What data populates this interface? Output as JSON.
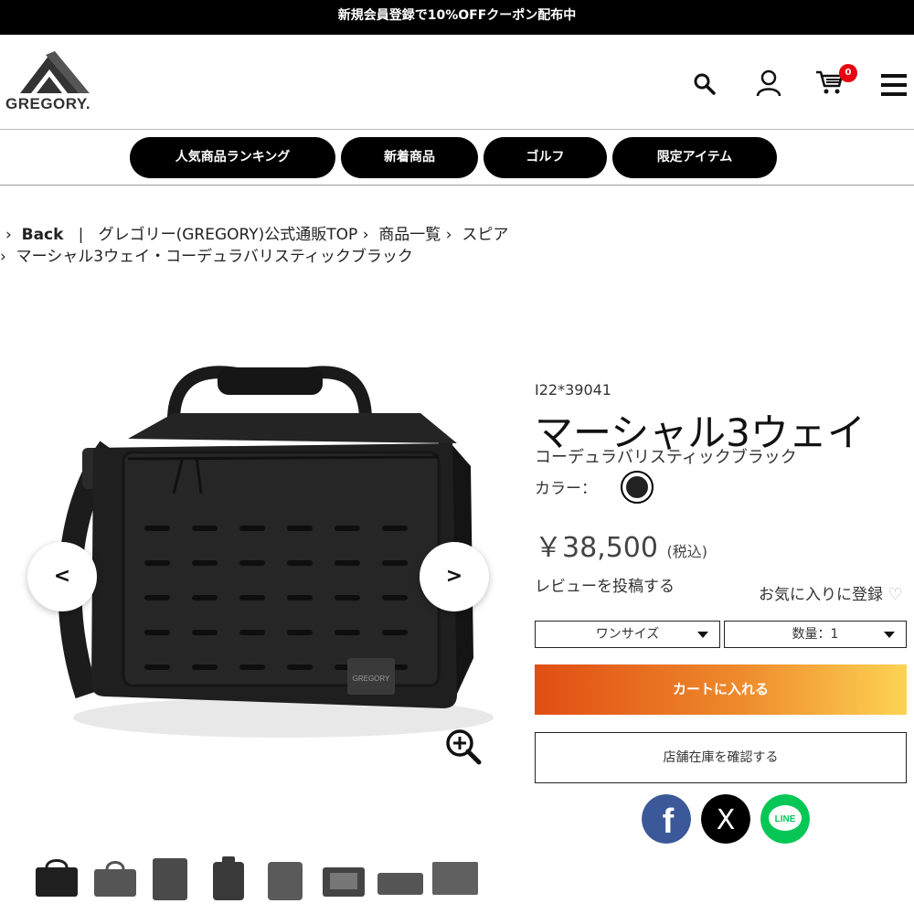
{
  "promo_bar": {
    "text": "新規会員登録で10%OFFクーポン配布中"
  },
  "header": {
    "logo_text": "GREGORY.",
    "cart_count": "0",
    "icons": [
      "search-icon",
      "user-icon",
      "cart-icon",
      "menu-icon"
    ]
  },
  "nav": {
    "items": [
      {
        "label": "人気商品ランキング"
      },
      {
        "label": "新着商品"
      },
      {
        "label": "ゴルフ"
      },
      {
        "label": "限定アイテム"
      }
    ]
  },
  "breadcrumb": {
    "back": "Back",
    "separator": "|",
    "items": [
      "グレゴリー(GREGORY)公式通販TOP",
      "商品一覧",
      "スピア"
    ],
    "current": "マーシャル3ウェイ・コーデュラバリスティックブラック"
  },
  "product": {
    "sku": "I22*39041",
    "name": "マーシャル3ウェイ",
    "subtitle": "コーデュラバリスティックブラック",
    "color_label": "カラー：",
    "color_swatch": "#222222",
    "price": "￥38,500",
    "tax_note": "(税込)",
    "review_link": "レビューを投稿する",
    "favorite_label": "お気に入りに登録",
    "size_select": "ワンサイズ",
    "quantity_select": "数量：1",
    "add_to_cart": "カートに入れる",
    "check_stock": "店舗在庫を確認する",
    "logo_patch_text": "GREGORY"
  },
  "gallery": {
    "thumbnail_count": 8
  },
  "social": [
    {
      "name": "facebook",
      "label": "f",
      "color": "#3b5998"
    },
    {
      "name": "x",
      "label": "X",
      "color": "#000000"
    },
    {
      "name": "line",
      "label": "LINE",
      "color": "#06c755"
    }
  ]
}
